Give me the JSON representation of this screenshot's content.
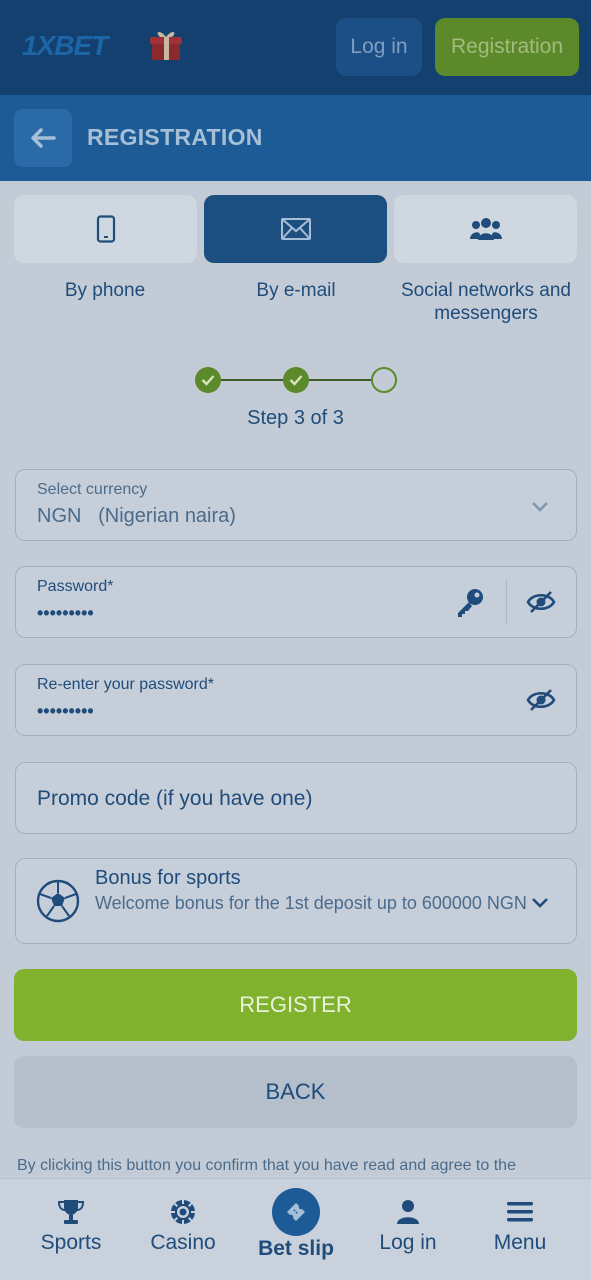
{
  "header": {
    "logo_text": "1XBET",
    "login_label": "Log in",
    "registration_label": "Registration"
  },
  "subheader": {
    "title": "REGISTRATION"
  },
  "methods": [
    {
      "label": "By phone",
      "icon": "phone-icon",
      "active": false
    },
    {
      "label": "By e-mail",
      "icon": "envelope-icon",
      "active": true
    },
    {
      "label": "Social networks and messengers",
      "icon": "people-icon",
      "active": false
    }
  ],
  "stepper": {
    "text": "Step 3 of 3",
    "current": 3,
    "total": 3
  },
  "form": {
    "currency": {
      "label": "Select currency",
      "value": "NGN   (Nigerian naira)"
    },
    "password": {
      "label": "Password*",
      "value": "•••••••••"
    },
    "repassword": {
      "label": "Re-enter your password*",
      "value": "•••••••••"
    },
    "promo": {
      "placeholder": "Promo code (if you have one)"
    },
    "bonus": {
      "title": "Bonus for sports",
      "description": "Welcome bonus for the 1st deposit up to 600000 NGN"
    }
  },
  "buttons": {
    "register": "REGISTER",
    "back": "BACK"
  },
  "disclaimer": "By clicking this button you confirm that you have read and agree to the",
  "bottom_nav": [
    {
      "label": "Sports",
      "icon": "trophy-icon"
    },
    {
      "label": "Casino",
      "icon": "casino-chip-icon"
    },
    {
      "label": "Bet slip",
      "icon": "ticket-icon"
    },
    {
      "label": "Log in",
      "icon": "user-icon"
    },
    {
      "label": "Menu",
      "icon": "hamburger-icon"
    }
  ],
  "colors": {
    "primary": "#13406e",
    "accent_green": "#80b22e",
    "overlay_bg": "#c3ccd6"
  }
}
